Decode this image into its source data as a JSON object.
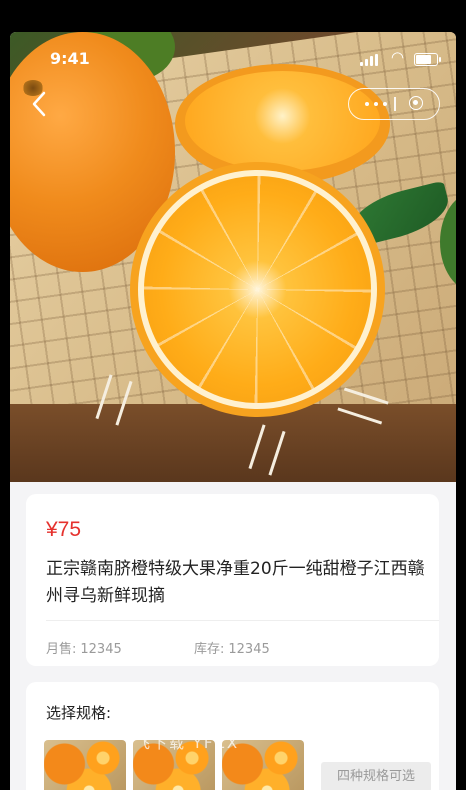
{
  "status_bar": {
    "time": "9:41"
  },
  "product": {
    "price": "¥75",
    "title": "正宗赣南脐橙特级大果净重20斤一纯甜橙子江西赣州寻乌新鲜现摘",
    "sales_label": "月售:",
    "sales_value": "12345",
    "stock_label": "库存:",
    "stock_value": "12345"
  },
  "spec": {
    "label": "选择规格:",
    "more_tag": "四种规格可选"
  },
  "watermark": "飞下载   YFZX",
  "colors": {
    "price": "#e5312d",
    "background": "#f4f4f6"
  }
}
